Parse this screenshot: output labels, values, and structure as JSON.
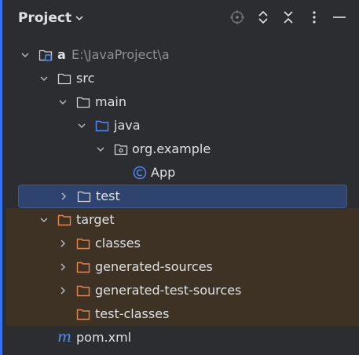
{
  "header": {
    "title": "Project"
  },
  "tree": {
    "root": {
      "label": "a",
      "path": "E:\\JavaProject\\a"
    },
    "src": "src",
    "main": "main",
    "java": "java",
    "package": "org.example",
    "app": "App",
    "test": "test",
    "target": "target",
    "classes": "classes",
    "generated_sources": "generated-sources",
    "generated_test_sources": "generated-test-sources",
    "test_classes": "test-classes",
    "pom": "pom.xml"
  },
  "icons": {
    "folder": "folder-icon",
    "source_root": "source-root-folder-icon",
    "package": "package-icon",
    "class": "class-icon",
    "maven": "maven-icon",
    "module": "module-icon"
  },
  "colors": {
    "background": "#2b2d30",
    "selection": "#2e436e",
    "excluded": "#3d3223",
    "accent": "#3574f0",
    "excluded_folder": "#e08855",
    "source_folder": "#548af7"
  }
}
